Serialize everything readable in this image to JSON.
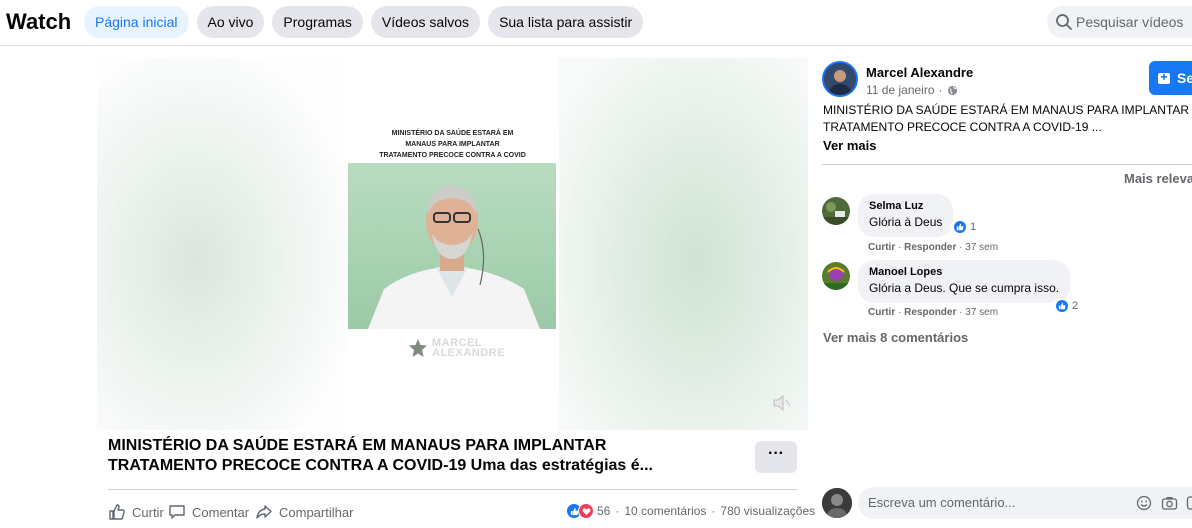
{
  "header": {
    "title": "Watch",
    "tabs": [
      {
        "label": "Página inicial",
        "active": true
      },
      {
        "label": "Ao vivo"
      },
      {
        "label": "Programas"
      },
      {
        "label": "Vídeos salvos"
      },
      {
        "label": "Sua lista para assistir"
      }
    ],
    "search_placeholder": "Pesquisar vídeos"
  },
  "video": {
    "headline_lines": [
      "MINISTÉRIO DA SAÚDE ESTARÁ EM",
      "MANAUS PARA IMPLANTAR",
      "TRATAMENTO PRECOCE CONTRA A COVID"
    ],
    "watermark_line1": "MARCEL",
    "watermark_line2": "ALEXANDRE",
    "title_line1": "MINISTÉRIO DA SAÚDE ESTARÁ EM MANAUS PARA IMPLANTAR",
    "title_line2": "TRATAMENTO PRECOCE CONTRA A COVID-19 Uma das estratégias é...",
    "more_label": "···",
    "actions": {
      "like": "Curtir",
      "comment": "Comentar",
      "share": "Compartilhar"
    },
    "stats": {
      "reactions": "56",
      "comments": "10 comentários",
      "views": "780 visualizações",
      "dot": "·"
    }
  },
  "post": {
    "author": "Marcel Alexandre",
    "date": "11 de janeiro",
    "dot": "·",
    "follow_label": "Se",
    "text_line1": "MINISTÉRIO DA SAÚDE ESTARÁ EM MANAUS PARA IMPLANTAR",
    "text_line2": "TRATAMENTO PRECOCE CONTRA A COVID-19 ...",
    "see_more": "Ver mais",
    "sort_label": "Mais releva"
  },
  "comments": [
    {
      "name": "Selma Luz",
      "text": "Glória à Deus",
      "like": "Curtir",
      "reply": "Responder",
      "time": "37 sem",
      "reactions": "1",
      "sep": "·"
    },
    {
      "name": "Manoel Lopes",
      "text": "Glória a Deus. Que se cumpra isso.",
      "like": "Curtir",
      "reply": "Responder",
      "time": "37 sem",
      "reactions": "2",
      "sep": "·"
    }
  ],
  "view_more_comments": "Ver mais 8 comentários",
  "composer": {
    "placeholder": "Escreva um comentário..."
  },
  "colors": {
    "accent": "#1877f2",
    "muted": "#65676b",
    "love": "#f33e58"
  }
}
